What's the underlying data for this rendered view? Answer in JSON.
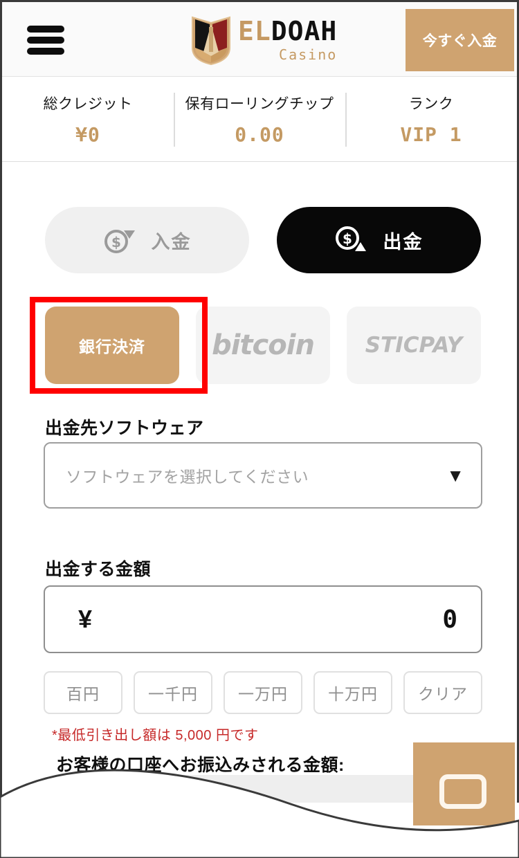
{
  "header": {
    "menu_icon": "hamburger-menu-icon",
    "logo": {
      "name_part1": "EL",
      "name_part2": "DOAH",
      "subtitle": "Casino",
      "mark_icon": "shield-pyramid-logo-icon"
    },
    "cta_label": "今すぐ入金"
  },
  "stats": [
    {
      "label": "総クレジット",
      "value": "¥0"
    },
    {
      "label": "保有ローリングチップ",
      "value": "0.00"
    },
    {
      "label": "ランク",
      "value": "VIP 1"
    }
  ],
  "tabs": [
    {
      "label": "入金",
      "icon": "coin-dollar-down-arrow-icon",
      "active": false
    },
    {
      "label": "出金",
      "icon": "coin-dollar-up-arrow-icon",
      "active": true
    }
  ],
  "payment_methods": [
    {
      "label": "銀行決済",
      "type": "text",
      "selected": true
    },
    {
      "label": "bitcoin",
      "type": "logo",
      "selected": false
    },
    {
      "label": "STICPAY",
      "type": "logo",
      "selected": false
    }
  ],
  "software_field": {
    "label": "出金先ソフトウェア",
    "placeholder": "ソフトウェアを選択してください",
    "value": "",
    "caret_icon": "chevron-down-icon"
  },
  "amount_field": {
    "label": "出金する金額",
    "currency_symbol": "¥",
    "value": "0"
  },
  "quick_amounts": [
    {
      "label": "百円"
    },
    {
      "label": "一千円"
    },
    {
      "label": "一万円"
    },
    {
      "label": "十万円"
    },
    {
      "label": "クリア"
    }
  ],
  "min_withdraw_note": "*最低引き出し額は 5,000 円です",
  "transfer_label": "お客様の口座へお振込みされる金額:",
  "fab": {
    "icon": "rounded-square-outline-icon"
  },
  "colors": {
    "brand_tan": "#cfa370",
    "gold_text": "#c49a63",
    "active_black": "#080808",
    "annotation_red": "#ff0000",
    "warning_red": "#c62828",
    "muted_gray": "#b6b6b6"
  }
}
